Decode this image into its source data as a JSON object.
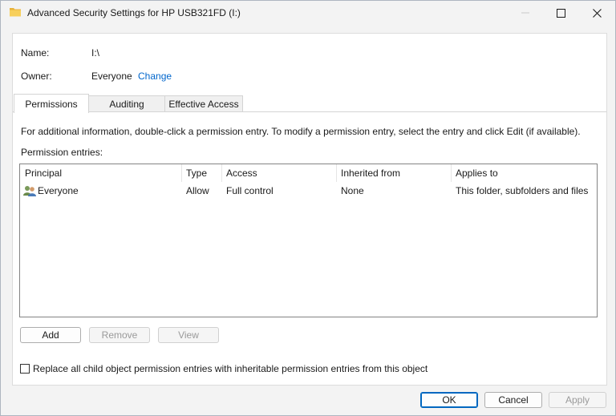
{
  "window": {
    "title": "Advanced Security Settings for HP USB321FD (I:)"
  },
  "info": {
    "name_label": "Name:",
    "name_value": "I:\\",
    "owner_label": "Owner:",
    "owner_value": "Everyone",
    "change_link": "Change"
  },
  "tabs": [
    {
      "label": "Permissions",
      "active": true
    },
    {
      "label": "Auditing",
      "active": false
    },
    {
      "label": "Effective Access",
      "active": false
    }
  ],
  "instructions": "For additional information, double-click a permission entry. To modify a permission entry, select the entry and click Edit (if available).",
  "entries_label": "Permission entries:",
  "table": {
    "columns": [
      "Principal",
      "Type",
      "Access",
      "Inherited from",
      "Applies to"
    ],
    "rows": [
      {
        "principal": "Everyone",
        "type": "Allow",
        "access": "Full control",
        "inherited": "None",
        "applies": "This folder, subfolders and files"
      }
    ]
  },
  "entry_buttons": {
    "add": "Add",
    "remove": "Remove",
    "view": "View"
  },
  "replace_checkbox": {
    "label": "Replace all child object permission entries with inheritable permission entries from this object",
    "checked": false
  },
  "footer_buttons": {
    "ok": "OK",
    "cancel": "Cancel",
    "apply": "Apply"
  },
  "colors": {
    "link": "#0066cc",
    "accent": "#0067c0",
    "folder_icon": "#f2c14e"
  }
}
